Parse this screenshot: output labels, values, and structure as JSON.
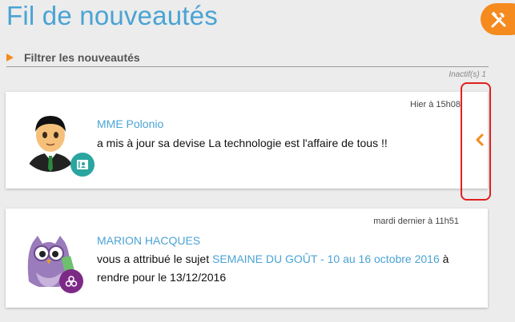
{
  "page": {
    "title": "Fil de nouveautés"
  },
  "toolbar": {
    "tools_icon": "tools-icon",
    "accent": "#f58a1f"
  },
  "filter": {
    "label": "Filtrer les nouveautés",
    "arrow_icon": "triangle-right-icon"
  },
  "inactive_label": "Inactif(s) 1",
  "colors": {
    "link": "#4aa3d4",
    "accent": "#f58a1f",
    "teal_badge": "#2aa5a0",
    "purple_badge": "#7d2a87",
    "highlight": "#e0201f"
  },
  "feed": [
    {
      "timestamp": "Hier à 15h08",
      "author": "MME Polonio",
      "message": "a mis à jour sa devise La technologie est l'affaire de tous !!",
      "avatar_icon": "boy-avatar",
      "badge_icon": "contact-card-icon",
      "expand_icon": "chevron-left-icon"
    },
    {
      "timestamp": "mardi dernier à 11h51",
      "author": "MARION HACQUES",
      "message_pre": "vous a attribué le sujet ",
      "message_link": "SEMAINE DU GOÛT - 10 au 16 octobre 2016",
      "message_post": " à rendre pour le 13/12/2016",
      "avatar_icon": "owl-avatar",
      "badge_icon": "bubbles-icon"
    }
  ]
}
